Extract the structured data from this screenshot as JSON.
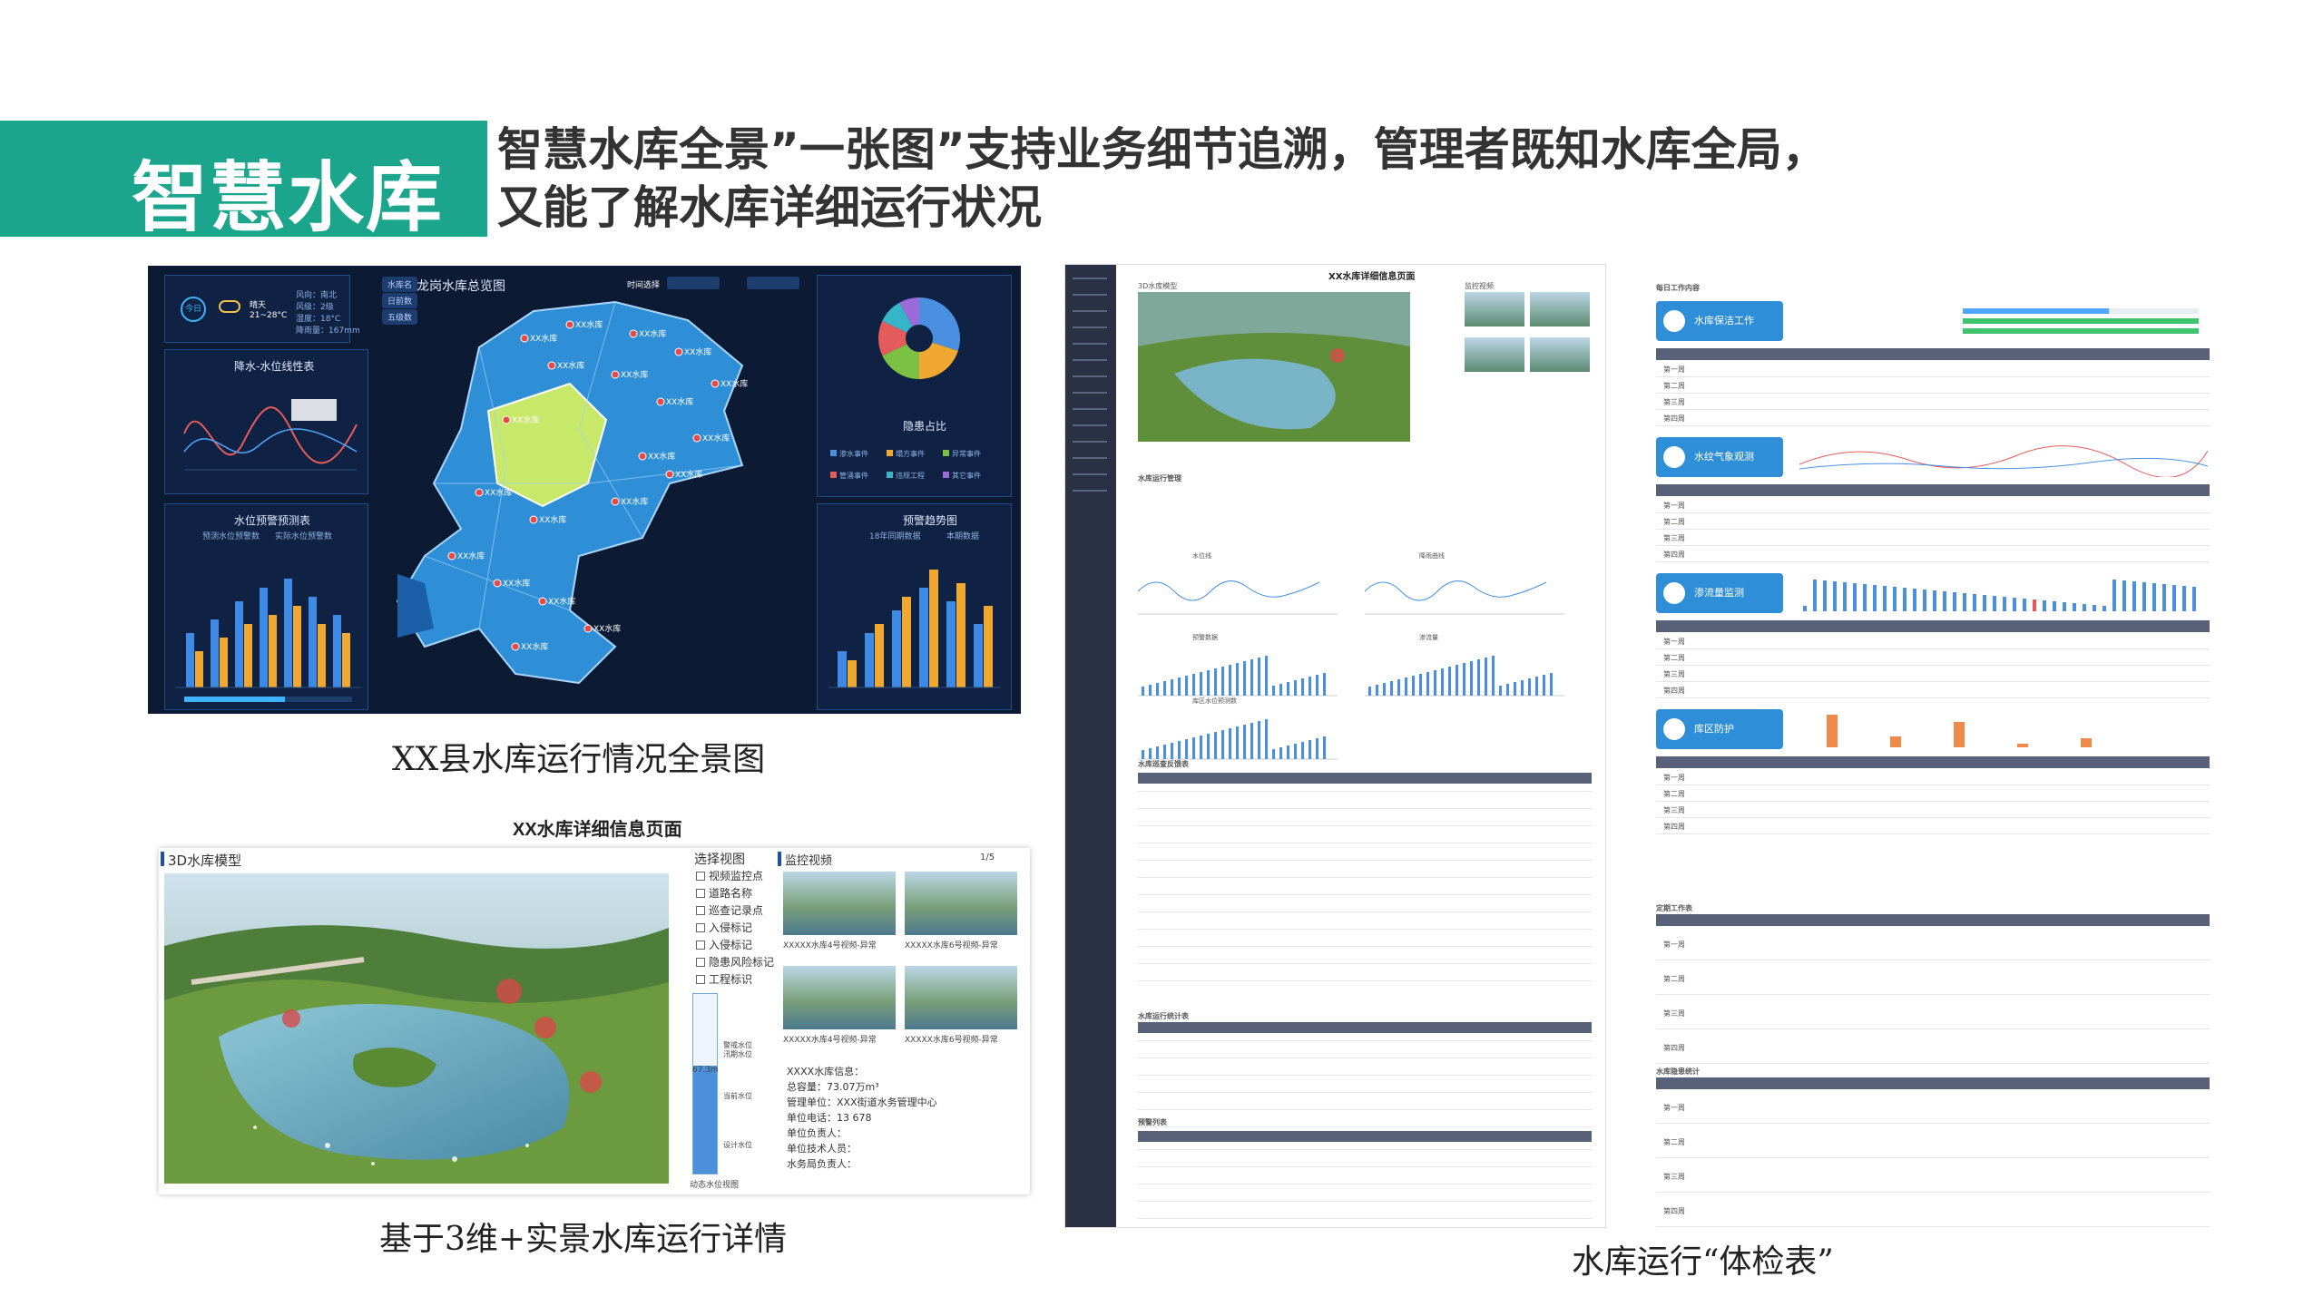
{
  "header": {
    "title": "智慧水库",
    "headline_line1": "智慧水库全景”一张图”支持业务细节追溯，管理者既知水库全局，",
    "headline_line2": "又能了解水库详细运行状况"
  },
  "panel_overview": {
    "caption": "XX县水库运行情况全景图",
    "dashboard_title": "龙岗水库总览图",
    "today": "今日",
    "weather": "晴天",
    "temperature": "21~28°C",
    "wind_dir_label": "风向：南北",
    "wind_level_label": "风级：2级",
    "humidity_label": "湿度：18°C",
    "rain_label": "降雨量：167mm",
    "chart1_title": "降水-水位线性表",
    "chart2_title": "水位预警预测表",
    "chart3_title": "隐患占比",
    "chart4_title": "预警趋势图",
    "time_select": "时间选择",
    "map_label": "XX水库",
    "side_tabs": [
      "水库名",
      "日前数",
      "五级数"
    ],
    "pie_legend": [
      "渗水事件",
      "塌方事件",
      "异常事件",
      "管涌事件",
      "违规工程",
      "其它事件"
    ],
    "bar_legend": [
      "预测水位预警数",
      "实际水位预警数"
    ],
    "trend_legend": [
      "18年同期数据",
      "本期数据"
    ],
    "colors": {
      "bg": "#0d1a33",
      "map": "#2f8fd6",
      "highlight": "#c8e86a",
      "bar_blue": "#3d8be6",
      "bar_orange": "#f0a830"
    }
  },
  "panel_detail": {
    "caption": "基于3维+实景水库运行详情",
    "page_title": "XX水库详细信息页面",
    "model_title": "3D水库模型",
    "view_title": "选择视图",
    "view_options": [
      "视频监控点",
      "道路名称",
      "巡查记录点",
      "入侵标记",
      "入侵标记",
      "隐患风险标记",
      "工程标识"
    ],
    "video_title": "监控视频",
    "pager": "1/5",
    "videos": [
      "XXXXX水库4号视频-异常",
      "XXXXX水库6号视频-异常",
      "XXXXX水库4号视频-异常",
      "XXXXX水库6号视频-异常"
    ],
    "water_level": "67.3m",
    "gauge_labels": [
      "警戒水位",
      "汛期水位",
      "当前水位",
      "设计水位"
    ],
    "gauge_bottom": "动态水位视图",
    "info": [
      "XXXX水库信息：",
      "总容量：73.07万m³",
      "管理单位：XXX街道水务管理中心",
      "单位电话：13          678",
      "单位负责人：",
      "单位技术人员：",
      "水务局负责人："
    ]
  },
  "panel_report": {
    "page_title": "XX水库详细信息页面",
    "model_title": "3D水库模型",
    "monitor_title": "监控视频",
    "operation_title": "水库运行管理",
    "chart_titles": [
      "水位线",
      "降雨曲线",
      "预警数据",
      "渗流量",
      "库区水位预测数"
    ],
    "table1_title": "水库巡查反馈表",
    "table2_title": "水库运行统计表",
    "table3_title": "预警列表"
  },
  "panel_check": {
    "caption": "水库运行“体检表”",
    "daily_title": "每日工作内容",
    "sections": [
      "水库保洁工作",
      "水纹气象观测",
      "渗流量监测",
      "库区防护"
    ],
    "regular_title": "定期工作表",
    "hazard_title": "水库隐患统计",
    "rows": [
      "第一周",
      "第二周",
      "第三周",
      "第四周"
    ]
  }
}
